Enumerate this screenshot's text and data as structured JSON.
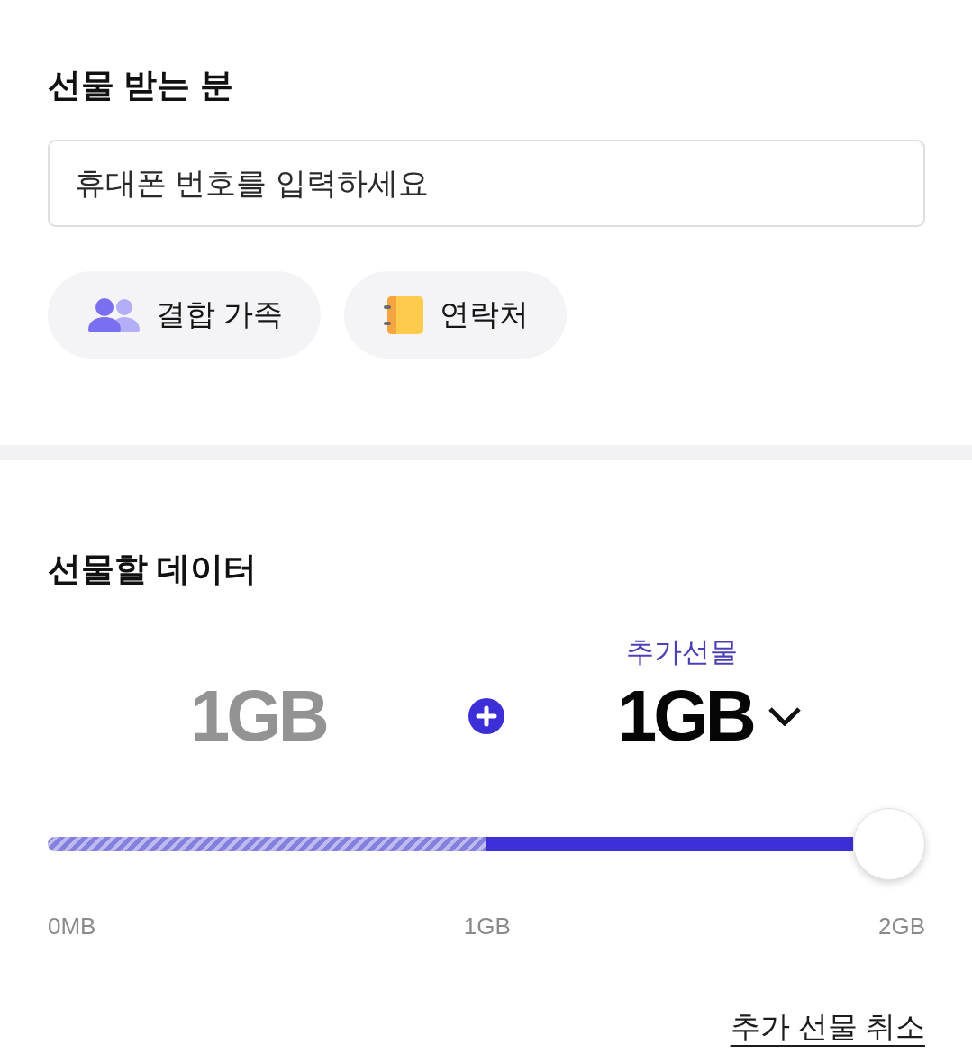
{
  "recipient": {
    "title": "선물 받는 분",
    "phone_field": {
      "placeholder": "휴대폰 번호를 입력하세요"
    },
    "shortcuts": [
      {
        "kind": "family",
        "label": "결합 가족"
      },
      {
        "kind": "contacts",
        "label": "연락처"
      }
    ]
  },
  "data_gift": {
    "title": "선물할 데이터",
    "base_amount": "1GB",
    "extra_label": "추가선물",
    "extra_amount": "1GB",
    "slider": {
      "level": 1,
      "base": {
        "level": 0.5
      },
      "ticks": [
        "0MB",
        "1GB",
        "2GB"
      ]
    },
    "cancel_link": "추가 선물 취소"
  }
}
